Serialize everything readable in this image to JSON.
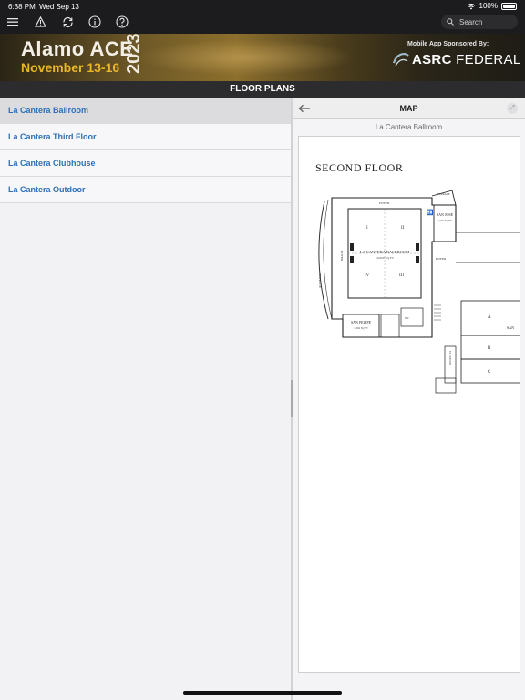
{
  "status": {
    "time": "6:38 PM",
    "date": "Wed Sep 13",
    "battery": "100%"
  },
  "toolbar": {
    "search_placeholder": "Search"
  },
  "banner": {
    "title": "Alamo ACE",
    "dates": "November 13-16",
    "year": "2023",
    "sponsor": "Mobile App Sponsored By:",
    "logo_brand": "ASRC",
    "logo_name": "FEDERAL"
  },
  "section_title": "FLOOR PLANS",
  "floor_plans": [
    {
      "label": "La Cantera Ballroom",
      "selected": true
    },
    {
      "label": "La Cantera Third Floor",
      "selected": false
    },
    {
      "label": "La Cantera Clubhouse",
      "selected": false
    },
    {
      "label": "La Cantera Outdoor",
      "selected": false
    }
  ],
  "map": {
    "title": "MAP",
    "subtitle": "La Cantera Ballroom",
    "floor_title": "SECOND FLOOR",
    "labels": {
      "foyer": "FOYER",
      "terrace": "TERRACE",
      "ballroom": "LA CANTERA BALLROOM",
      "ballroom_size": "10,000 SQ FT",
      "section_i": "I",
      "section_ii": "II",
      "section_iii": "III",
      "section_iv": "IV",
      "san_jose": "SAN JOSE",
      "san_jose_size": "1,575 SQ FT",
      "san_felipe": "SAN FELIPE",
      "san_felipe_size": "1,394 SQ FT",
      "a": "A",
      "b": "B",
      "c": "C",
      "san": "SAN",
      "elevator": "ELEVATOR",
      "wc": "WC"
    }
  },
  "colors": {
    "link": "#2f6fb5",
    "gold": "#e8b628"
  }
}
